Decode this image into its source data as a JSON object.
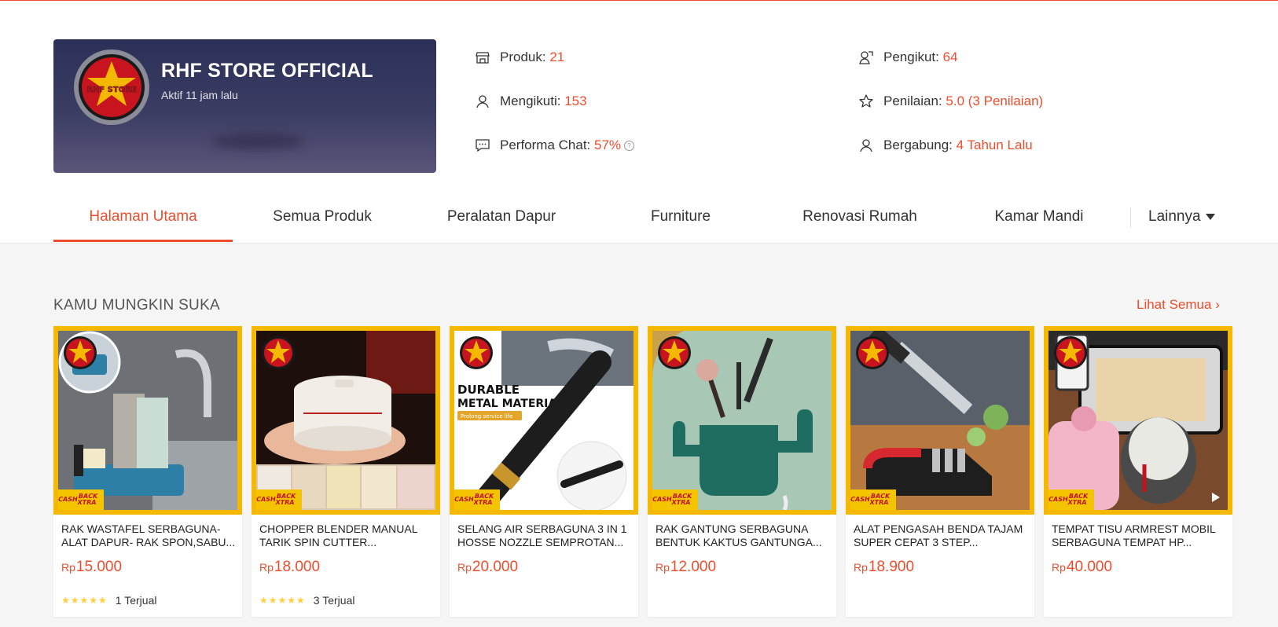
{
  "colors": {
    "accent": "#ee4d2d",
    "card_border": "#f5b800"
  },
  "shop": {
    "name": "RHF STORE OFFICIAL",
    "active": "Aktif 11 jam lalu",
    "avatar_text": "RHF STORE"
  },
  "stats": {
    "produk": {
      "label": "Produk: ",
      "value": "21",
      "icon": "store-icon"
    },
    "mengikuti": {
      "label": "Mengikuti: ",
      "value": "153",
      "icon": "user-icon"
    },
    "chat": {
      "label": "Performa Chat: ",
      "value": "57%",
      "help": "?",
      "icon": "chat-icon"
    },
    "pengikut": {
      "label": "Pengikut: ",
      "value": "64",
      "icon": "followers-icon"
    },
    "penilaian": {
      "label": "Penilaian: ",
      "value": "5.0 (3 Penilaian)",
      "icon": "star-icon"
    },
    "bergabung": {
      "label": "Bergabung: ",
      "value": "4 Tahun Lalu",
      "icon": "user-join-icon"
    }
  },
  "tabs": [
    "Halaman Utama",
    "Semua Produk",
    "Peralatan Dapur",
    "Furniture",
    "Renovasi Rumah",
    "Kamar Mandi"
  ],
  "tab_more": "Lainnya",
  "section": {
    "title": "KAMU MUNGKIN SUKA",
    "see_all": "Lihat Semua"
  },
  "badge": {
    "line1": "CASH",
    "line2": "BACK XTRA"
  },
  "products": [
    {
      "name": "RAK WASTAFEL SERBAGUNA-ALAT DAPUR- RAK SPON,SABU...",
      "currency": "Rp",
      "price": "15.000",
      "stars": "★★★★★",
      "sold": "1 Terjual"
    },
    {
      "name": "CHOPPER BLENDER MANUAL TARIK SPIN CUTTER...",
      "currency": "Rp",
      "price": "18.000",
      "stars": "★★★★★",
      "sold": "3 Terjual"
    },
    {
      "name": "SELANG AIR SERBAGUNA 3 IN 1 HOSSE NOZZLE SEMPROTAN...",
      "currency": "Rp",
      "price": "20.000",
      "img_text1": "DURABLE",
      "img_text2": "METAL MATERIAL",
      "img_text3": "Prolong service life"
    },
    {
      "name": "RAK GANTUNG SERBAGUNA BENTUK KAKTUS GANTUNGA...",
      "currency": "Rp",
      "price": "12.000"
    },
    {
      "name": "ALAT PENGASAH BENDA TAJAM SUPER CEPAT 3 STEP...",
      "currency": "Rp",
      "price": "18.900"
    },
    {
      "name": "TEMPAT TISU ARMREST MOBIL SERBAGUNA TEMPAT HP...",
      "currency": "Rp",
      "price": "40.000"
    }
  ]
}
